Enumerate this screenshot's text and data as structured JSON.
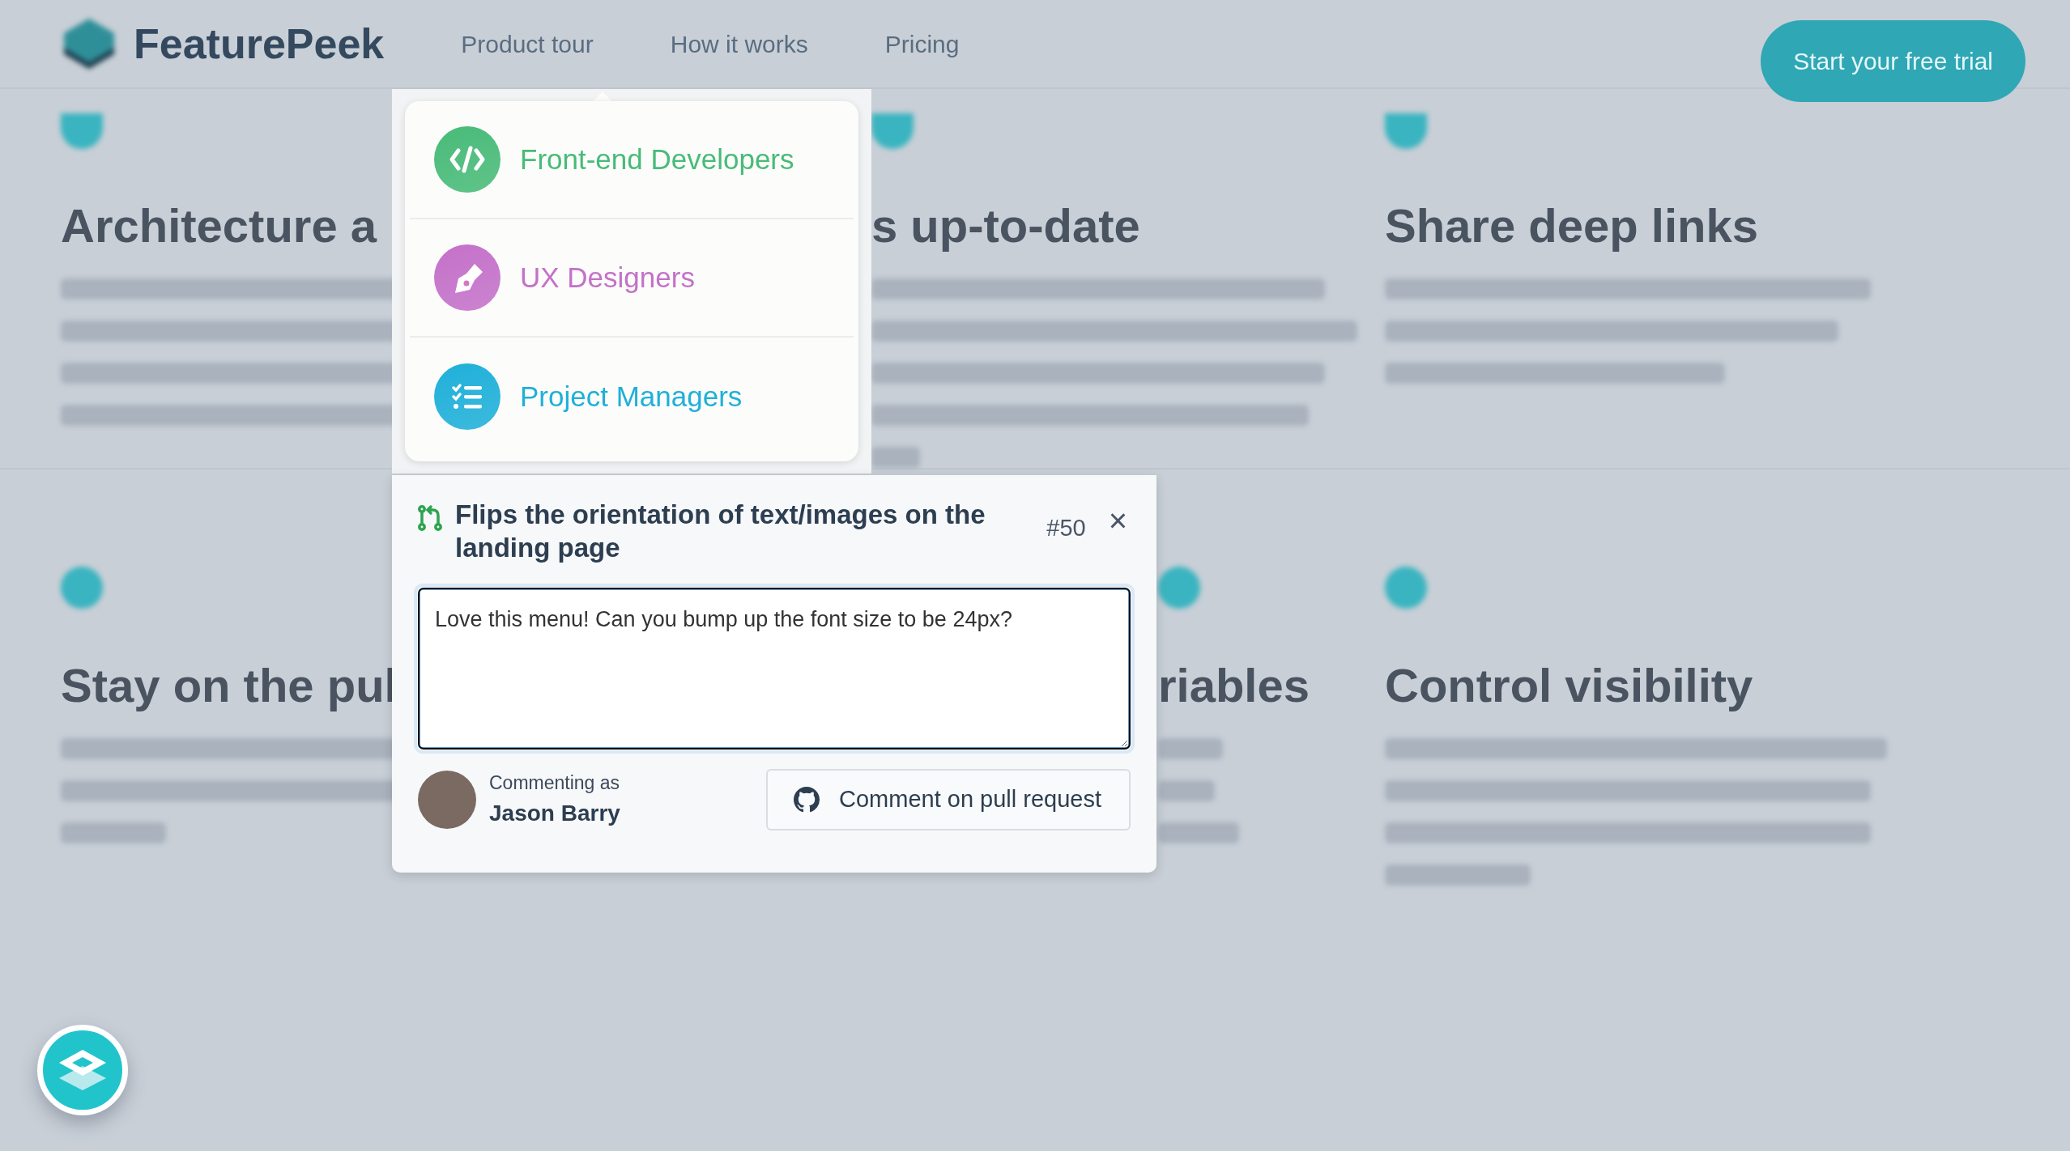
{
  "nav": {
    "brand": "FeaturePeek",
    "links": [
      "Product tour",
      "How it works",
      "Pricing"
    ],
    "cta": "Start your free trial"
  },
  "features": [
    {
      "title": "Architecture a"
    },
    {
      "title": "s up-to-date"
    },
    {
      "title": "Share deep links"
    },
    {
      "title": "Stay on the pul"
    },
    {
      "title": "riables"
    },
    {
      "title": "Control visibility"
    }
  ],
  "menu": {
    "items": [
      {
        "label": "Front-end Developers",
        "kind": "code",
        "color": "#48bb78"
      },
      {
        "label": "UX Designers",
        "kind": "pen",
        "color": "#c471c9"
      },
      {
        "label": "Project Managers",
        "kind": "list",
        "color": "#1fb0d9"
      }
    ]
  },
  "pull_request": {
    "title": "Flips the orientation of text/images on the landing page",
    "number": "#50",
    "close": "×",
    "comment": "Love this menu! Can you bump up the font size to be 24px?",
    "author_caption": "Commenting as",
    "author": "Jason Barry",
    "submit": "Comment on pull request"
  }
}
